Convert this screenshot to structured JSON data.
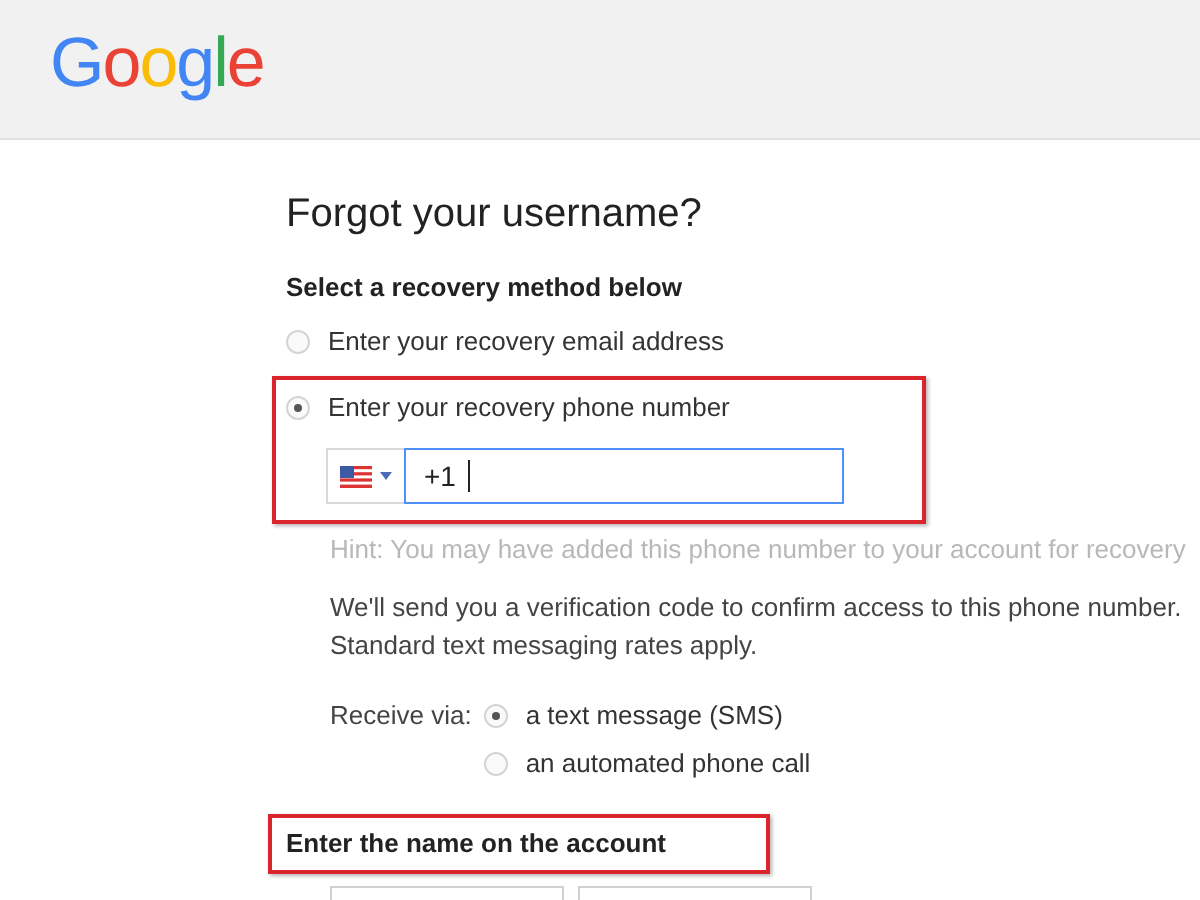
{
  "logo": "Google",
  "title": "Forgot your username?",
  "method_heading": "Select a recovery method below",
  "methods": [
    {
      "label": "Enter your recovery email address",
      "selected": false,
      "highlighted": false
    },
    {
      "label": "Enter your recovery phone number",
      "selected": true,
      "highlighted": true
    }
  ],
  "phone": {
    "value": "+1",
    "focused": true
  },
  "hint": "Hint: You may have added this phone number to your account for recovery",
  "info": "We'll send you a verification code to confirm access to this phone number. Standard text messaging rates apply.",
  "receive": {
    "label": "Receive via:",
    "options": [
      {
        "label": "a text message (SMS)",
        "selected": true
      },
      {
        "label": "an automated phone call",
        "selected": false
      }
    ]
  },
  "name_section": {
    "heading": "Enter the name on the account",
    "highlighted": true
  }
}
